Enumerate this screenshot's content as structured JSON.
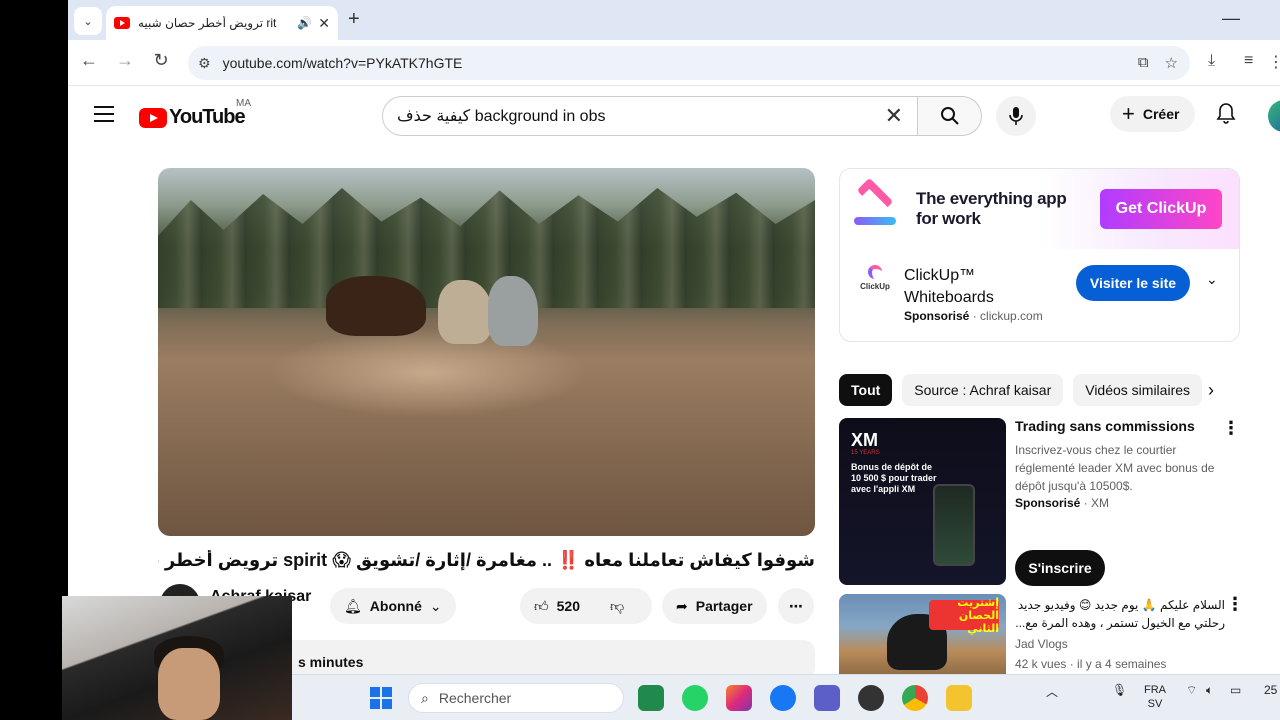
{
  "browser": {
    "tab_title": "rit ترويض أخطر حصان شبيه",
    "tab_audio_icon": "🔊",
    "url": "youtube.com/watch?v=PYkATK7hGTE"
  },
  "youtube": {
    "logo_text": "YouTube",
    "country": "MA",
    "search_value": "كيفية حذف background in obs",
    "create_label": "Créer"
  },
  "video": {
    "title": "شوفوا كيفاش تعاملنا معاه ‼️ .. مغامرة /إثارة /تشويق 😱 spirit ترويض أخطر حصان شبيه",
    "channel": "Achraf kaisar",
    "subscribe_label": "Abonné",
    "likes": "520",
    "share_label": "Partager",
    "desc_partial": "s minutes"
  },
  "ad": {
    "banner_text_1": "The everything app",
    "banner_text_2": "for work",
    "banner_cta": "Get ClickUp",
    "small_logo": "ClickUp",
    "name_1": "ClickUp™",
    "name_2": "Whiteboards",
    "sponsored": "Sponsorisé",
    "domain": "clickup.com",
    "visit_label": "Visiter le site"
  },
  "chips": [
    "Tout",
    "Source : Achraf kaisar",
    "Vidéos similaires"
  ],
  "sidebar_ad": {
    "thumb_logo": "XM",
    "thumb_sub": "15 YEARS",
    "thumb_text": "Bonus de dépôt de 10 500 $ pour trader avec l'appli XM",
    "title": "Trading sans commissions",
    "desc": "Inscrivez-vous chez le courtier réglementé leader XM avec bonus de dépôt jusqu'à 10500$.",
    "sponsored": "Sponsorisé",
    "advertiser": "XM",
    "subscribe_label": "S'inscrire"
  },
  "next_video": {
    "badge": "إشتريت الحصان الثاني",
    "title": "السلام عليكم 🙏 يوم جديد 😊 وفيديو جديد رحلتي مع الخيول تستمر ، وهده المرة مع...",
    "channel": "Jad Vlogs",
    "views": "42 k vues",
    "age": "il y a 4 semaines"
  },
  "taskbar": {
    "search_placeholder": "Rechercher",
    "lang_1": "FRA",
    "lang_2": "SV",
    "time_partial": "25"
  }
}
